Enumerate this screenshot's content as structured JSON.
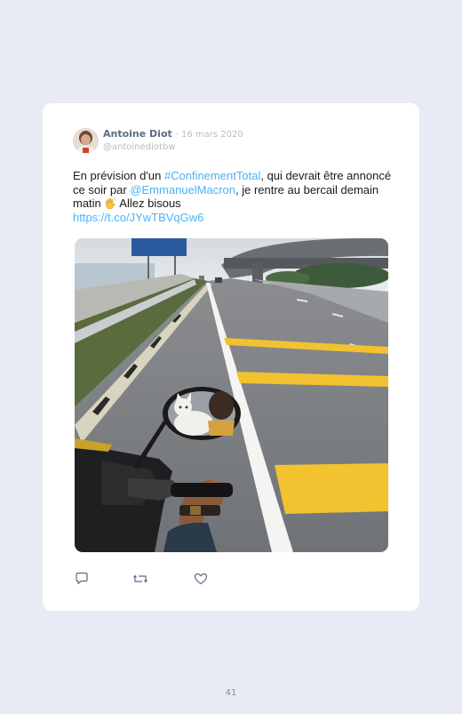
{
  "tweet": {
    "author_name": "Antoine Diot",
    "separator": "·",
    "date": "16 mars 2020",
    "handle": "@antoinediotbw",
    "text_1": "En prévision d'un ",
    "hashtag": "#ConfinementTotal",
    "text_2": ", qui devrait être annoncé ce soir par ",
    "mention": "@EmmanuelMacron",
    "text_3": ", je rentre au bercail demain matin ",
    "emoji_icon": "waving-hand-icon",
    "text_4": " Allez bisous",
    "url": "https://t.co/JYwTBVqGw6",
    "link_color": "#4ab3f4"
  },
  "actions": {
    "icons": [
      "reply-icon",
      "retweet-icon",
      "like-icon"
    ]
  },
  "page": {
    "number": "41"
  }
}
